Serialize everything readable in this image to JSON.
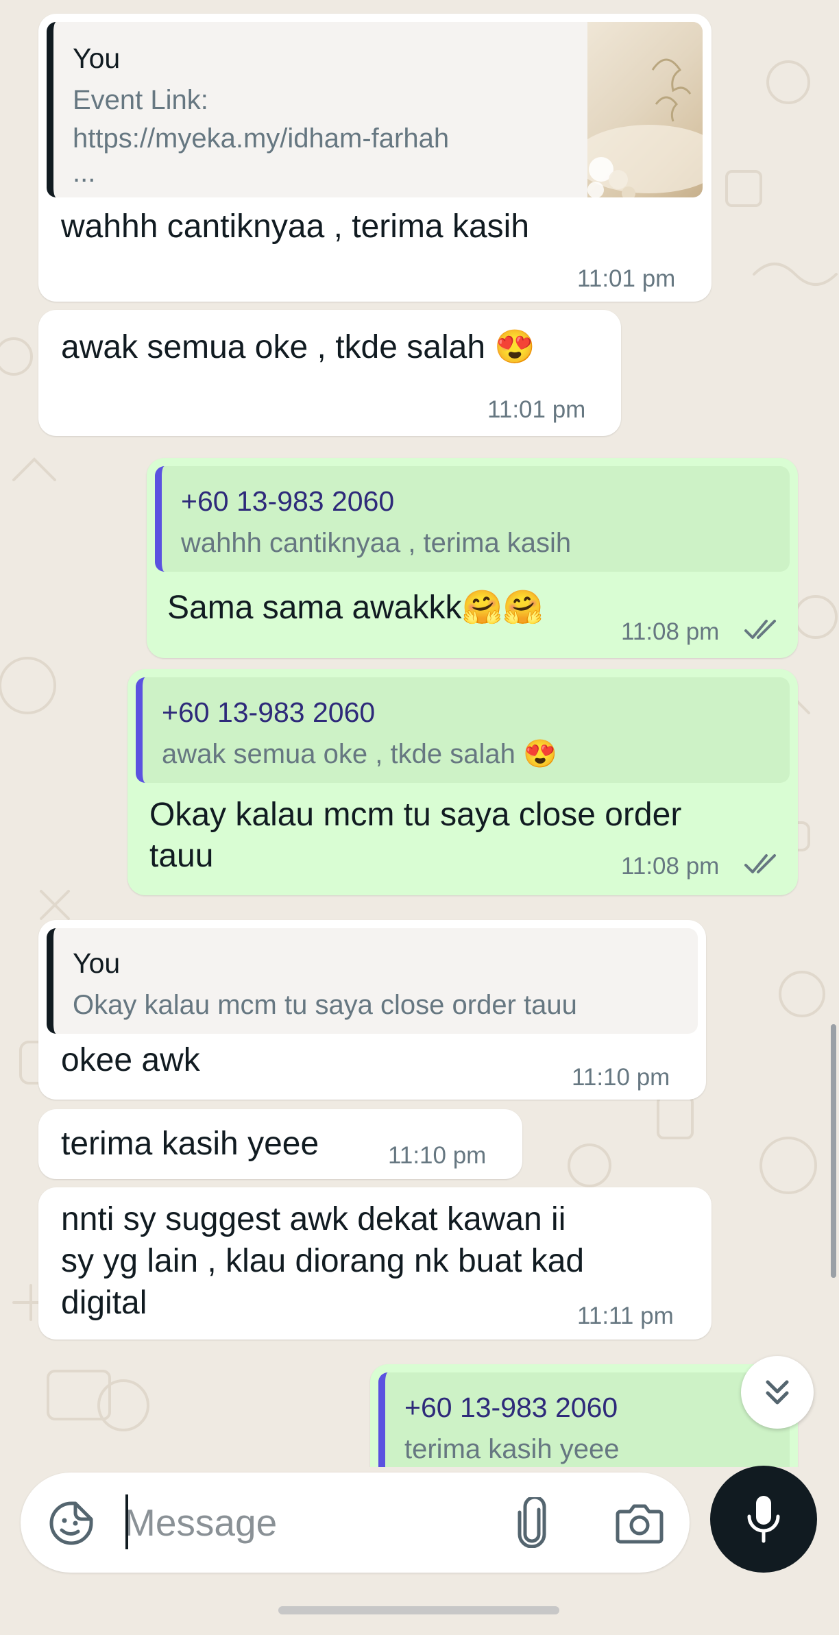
{
  "colors": {
    "wallpaper": "#efeae2",
    "incoming_bubble": "#ffffff",
    "outgoing_bubble": "#d9fdd3",
    "read_ticks": "#667781",
    "mic_button": "#111b21"
  },
  "messages": [
    {
      "direction": "incoming",
      "quote": {
        "author": "You",
        "text_line1": "Event Link:",
        "text_line2": "https://myeka.my/idham-farhah",
        "text_line3": "...",
        "has_thumbnail": true
      },
      "text": "wahhh cantiknyaa , terima kasih",
      "time": "11:01 pm"
    },
    {
      "direction": "incoming",
      "text": "awak semua oke , tkde salah 😍",
      "time": "11:01 pm"
    },
    {
      "direction": "outgoing",
      "quote": {
        "author": "+60 13-983 2060",
        "text": "wahhh cantiknyaa , terima kasih"
      },
      "text": "Sama sama awakkk🤗🤗",
      "time": "11:08 pm",
      "status": "read"
    },
    {
      "direction": "outgoing",
      "quote": {
        "author": "+60 13-983 2060",
        "text": "awak semua oke , tkde salah 😍"
      },
      "text_line1": "Okay kalau mcm tu saya close order",
      "text_line2": "tauu",
      "time": "11:08 pm",
      "status": "read"
    },
    {
      "direction": "incoming",
      "quote": {
        "author": "You",
        "text": "Okay kalau mcm tu saya close order tauu"
      },
      "text": "okee awk",
      "time": "11:10 pm"
    },
    {
      "direction": "incoming",
      "text": "terima kasih yeee",
      "time": "11:10 pm"
    },
    {
      "direction": "incoming",
      "text_line1": "nnti sy suggest awk dekat kawan ii",
      "text_line2": "sy yg lain , klau diorang nk buat kad",
      "text_line3": "digital",
      "time": "11:11 pm"
    },
    {
      "direction": "outgoing",
      "quote": {
        "author": "+60 13-983 2060",
        "text": "terima kasih yeee"
      }
    }
  ],
  "composer": {
    "placeholder": "Message",
    "emoji_icon": "sticker-emoji-icon",
    "attach_icon": "paperclip-icon",
    "camera_icon": "camera-icon",
    "mic_icon": "microphone-icon"
  },
  "scroll_button_icon": "double-chevron-down-icon"
}
